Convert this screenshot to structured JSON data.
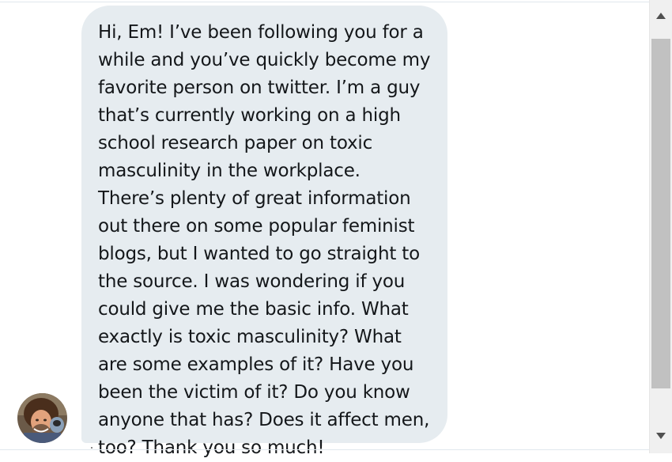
{
  "conversation": {
    "message": {
      "text": "Hi, Em! I’ve been following you for a while and you’ve quickly become my favorite person on twitter. I’m a guy that’s currently working on a high school research paper on toxic masculinity in the workplace. There’s plenty of great information out there on some popular feminist blogs, but I wanted to go straight to the source. I was wondering if you could give me the basic info. What exactly is toxic masculinity? What are some examples of it? Have you been the victim of it? Do you know anyone that has? Does it affect men, too? Thank you so much!"
    },
    "avatar_icon": "user-avatar-photo"
  },
  "scrollbar": {
    "up_icon": "triangle-up",
    "down_icon": "triangle-down"
  },
  "colors": {
    "bubble_bg": "#e6ecf0",
    "text": "#14171a",
    "scrollbar_track": "#f0f0f0",
    "scrollbar_thumb": "#c1c1c1"
  }
}
